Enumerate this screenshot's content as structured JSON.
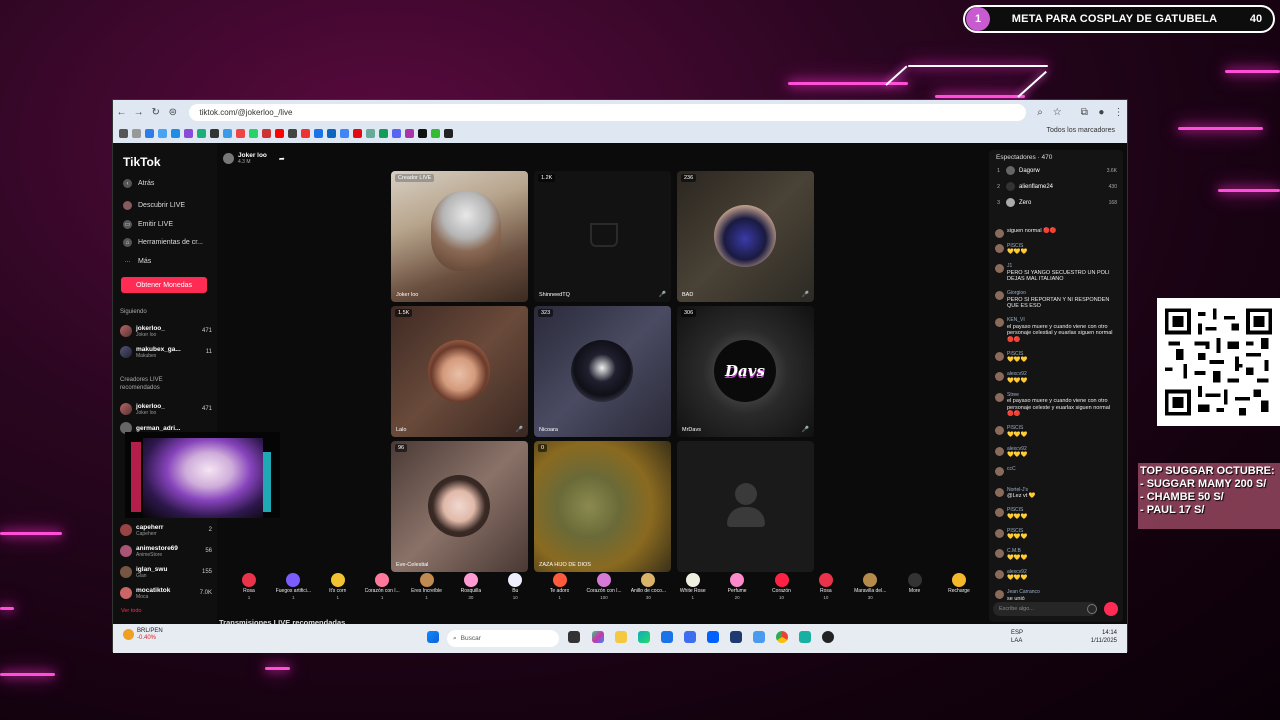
{
  "overlay": {
    "goal": {
      "number": "1",
      "title": "META PARA COSPLAY DE GATUBELA",
      "count": "40"
    },
    "sugar_board": {
      "title": "TOP SUGGAR OCTUBRE:",
      "lines": [
        "- SUGGAR MAMY 200 S/",
        "- CHAMBE 50 S/",
        "- PAUL  17 S/"
      ]
    }
  },
  "browser": {
    "url": "tiktok.com/@jokerloo_/live",
    "bookmarks_folder": "Todos los marcadores"
  },
  "tiktok": {
    "logo": "TikTok",
    "nav": {
      "back": "Atrás",
      "discover": "Descubrir LIVE",
      "go_live": "Emitir LIVE",
      "tools": "Herramientas de cr...",
      "more": "Más"
    },
    "coins_button": "Obtener Monedas",
    "following_header": "Siguiendo",
    "following": [
      {
        "name": "jokerloo_",
        "sub": "Joker loo",
        "count": "471"
      },
      {
        "name": "makubex_ga...",
        "sub": "Makubex",
        "count": "11"
      }
    ],
    "recommended_header": "Creadores LIVE recomendados",
    "recommended": [
      {
        "name": "jokerloo_",
        "sub": "Joker loo",
        "count": "471"
      },
      {
        "name": "german_adri...",
        "sub": "",
        "count": ""
      },
      {
        "name": "capeherr",
        "sub": "Capeherr",
        "count": "2"
      },
      {
        "name": "animestore69",
        "sub": "AnimeStore",
        "count": "56"
      },
      {
        "name": "iglan_swu",
        "sub": "Glan",
        "count": "155"
      },
      {
        "name": "mocatiktok",
        "sub": "Moca",
        "count": "7.0K"
      }
    ],
    "see_all": "Ver todo",
    "host": {
      "name": "Joker loo",
      "likes": "4.3 M"
    },
    "tiles": [
      {
        "badge": "Creador LIVE",
        "name": "Joker loo",
        "mic": ""
      },
      {
        "badge": "1.2K",
        "name": "ShinneedTQ",
        "mic": "🎤"
      },
      {
        "badge": "236",
        "name": "BAD",
        "mic": "🎤"
      },
      {
        "badge": "1.5K",
        "name": "Lalo",
        "mic": "🎤"
      },
      {
        "badge": "323",
        "name": "Nicoara",
        "mic": ""
      },
      {
        "badge": "306",
        "name": "MrDavs",
        "mic": "🎤"
      },
      {
        "badge": "96",
        "name": "Eve-Celestial",
        "mic": ""
      },
      {
        "badge": "0",
        "name": "ZAZA HIJO DE DIOS",
        "mic": ""
      },
      {
        "badge": "",
        "name": "",
        "mic": ""
      }
    ],
    "davs_logo": "Davs",
    "gifts": [
      {
        "name": "Rosa",
        "price": "1",
        "color": "#e8334a"
      },
      {
        "name": "Fuegos artifici...",
        "price": "1",
        "color": "#7a5cff"
      },
      {
        "name": "It's corn",
        "price": "1",
        "color": "#f2c230"
      },
      {
        "name": "Corazón con l...",
        "price": "1",
        "color": "#ff7a9a"
      },
      {
        "name": "Eres Increíble",
        "price": "1",
        "color": "#c08a50"
      },
      {
        "name": "Rosquilla",
        "price": "30",
        "color": "#ff9ad5"
      },
      {
        "name": "Bu",
        "price": "10",
        "color": "#eeeeff"
      },
      {
        "name": "Te adoro",
        "price": "1",
        "color": "#ff5a3c"
      },
      {
        "name": "Corazón con l...",
        "price": "100",
        "color": "#d67ad6"
      },
      {
        "name": "Anillo de coco...",
        "price": "30",
        "color": "#d9b36a"
      },
      {
        "name": "White Rose",
        "price": "1",
        "color": "#f0f0e0"
      },
      {
        "name": "Perfume",
        "price": "20",
        "color": "#ff8acb"
      },
      {
        "name": "Corazón",
        "price": "10",
        "color": "#ff2244"
      },
      {
        "name": "Rosa",
        "price": "10",
        "color": "#e8334a"
      },
      {
        "name": "Maravilla del...",
        "price": "30",
        "color": "#b58a4a"
      },
      {
        "name": "More",
        "price": "",
        "color": "#333333"
      },
      {
        "name": "Recharge",
        "price": "",
        "color": "#f5b82a"
      }
    ],
    "recommended_lives": "Transmisiones LIVE recomendadas",
    "chat": {
      "header": "Espectadores · 470",
      "top_viewers": [
        {
          "rank": "1",
          "name": "Dagorw",
          "score": "3.6K"
        },
        {
          "rank": "2",
          "name": "alienflame24",
          "score": "430"
        },
        {
          "rank": "3",
          "name": "Zero",
          "score": "168"
        }
      ],
      "messages": [
        {
          "user": "",
          "text": "siguen normal 🔴🔴"
        },
        {
          "user": "PISCIS",
          "text": "💛💛💛"
        },
        {
          "user": "J1",
          "text": "PERO SI YANGO SECUESTRO UN POLI DEJAS MAL ITALIANO"
        },
        {
          "user": "Giorgioo",
          "text": "PERO SI REPORTAN Y NI RESPONDEN QUE ES ESO"
        },
        {
          "user": "KEN_VI",
          "text": "el payaso muere y cuando viene con otro personaje celestial y euarlax siguen normal 🔴🔴"
        },
        {
          "user": "PISCIS",
          "text": "💛💛💛"
        },
        {
          "user": "alexcv92",
          "text": "💛💛💛"
        },
        {
          "user": "Stree",
          "text": "el payaso muere y cuando viene con otro personaje celeste y euarlax siguen normal 🔴🔴"
        },
        {
          "user": "PISCIS",
          "text": "💛💛💛"
        },
        {
          "user": "alexcv92",
          "text": "💛💛💛"
        },
        {
          "user": "ccC",
          "text": ""
        },
        {
          "user": "Nortel-J's",
          "text": "@Lez vt 💛"
        },
        {
          "user": "PISCIS",
          "text": "💛💛💛"
        },
        {
          "user": "PISCIS",
          "text": "💛💛💛"
        },
        {
          "user": "C.M.B",
          "text": "💛💛💛"
        },
        {
          "user": "alexcv92",
          "text": "💛💛💛"
        },
        {
          "user": "Jean Carranco",
          "text": "se unió"
        }
      ],
      "input_placeholder": "Escribe algo..."
    }
  },
  "taskbar": {
    "ticker": "BRL/PEN",
    "change": "-0.40%",
    "search_placeholder": "Buscar",
    "lang": "ESP",
    "lang_sub": "LAA",
    "time": "14:14",
    "date": "1/11/2025"
  }
}
